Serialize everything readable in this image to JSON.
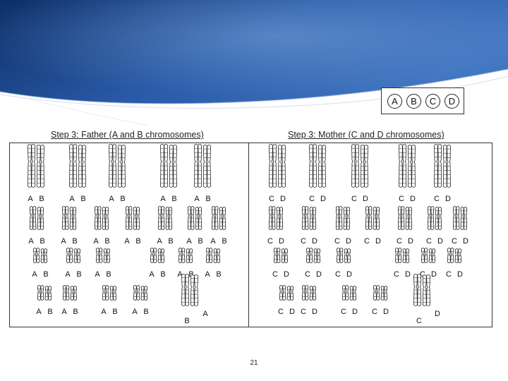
{
  "key": {
    "items": [
      "A",
      "B",
      "C",
      "D"
    ]
  },
  "father": {
    "title": "Step 3: Father (A and B chromosomes)",
    "rows": [
      {
        "groups": [
          [
            "A",
            "B"
          ],
          [
            "A",
            "B"
          ],
          [
            "A",
            "B"
          ],
          [
            "A",
            "B"
          ],
          [
            "A",
            "B"
          ]
        ]
      },
      {
        "groups": [
          [
            "A",
            "B"
          ],
          [
            "A",
            "B"
          ],
          [
            "A",
            "B"
          ],
          [
            "A",
            "B"
          ],
          [
            "A",
            "B"
          ],
          [
            "A",
            "B"
          ],
          [
            "A",
            "B"
          ]
        ]
      },
      {
        "groups": [
          [
            "A",
            "B"
          ],
          [
            "A",
            "B"
          ],
          [
            "A",
            "B"
          ],
          [
            "A",
            "B"
          ],
          [
            "A",
            "B"
          ],
          [
            "A",
            "B"
          ]
        ]
      },
      {
        "groups": [
          [
            "A",
            "B"
          ],
          [
            "A",
            "B"
          ],
          [
            "A",
            "B"
          ],
          [
            "A",
            "B"
          ],
          [
            "B",
            "A"
          ]
        ]
      }
    ]
  },
  "mother": {
    "title": "Step 3: Mother (C and D chromosomes)",
    "rows": [
      {
        "groups": [
          [
            "C",
            "D"
          ],
          [
            "C",
            "D"
          ],
          [
            "C",
            "D"
          ],
          [
            "C",
            "D"
          ],
          [
            "C",
            "D"
          ]
        ]
      },
      {
        "groups": [
          [
            "C",
            "D"
          ],
          [
            "C",
            "D"
          ],
          [
            "C",
            "D"
          ],
          [
            "C",
            "D"
          ],
          [
            "C",
            "D"
          ],
          [
            "C",
            "D"
          ],
          [
            "C",
            "D"
          ]
        ]
      },
      {
        "groups": [
          [
            "C",
            "D"
          ],
          [
            "C",
            "D"
          ],
          [
            "C",
            "D"
          ],
          [
            "C",
            "D"
          ],
          [
            "C",
            "D"
          ],
          [
            "C",
            "D"
          ]
        ]
      },
      {
        "groups": [
          [
            "C",
            "D"
          ],
          [
            "C",
            "D"
          ],
          [
            "C",
            "D"
          ],
          [
            "C",
            "D"
          ],
          [
            "C",
            "D"
          ]
        ]
      }
    ]
  },
  "page_number": "21",
  "colors": {
    "banner_dark": "#0d2f66",
    "banner_mid": "#2a5aa8",
    "banner_light": "#5a8fd0",
    "ink": "#222222"
  }
}
